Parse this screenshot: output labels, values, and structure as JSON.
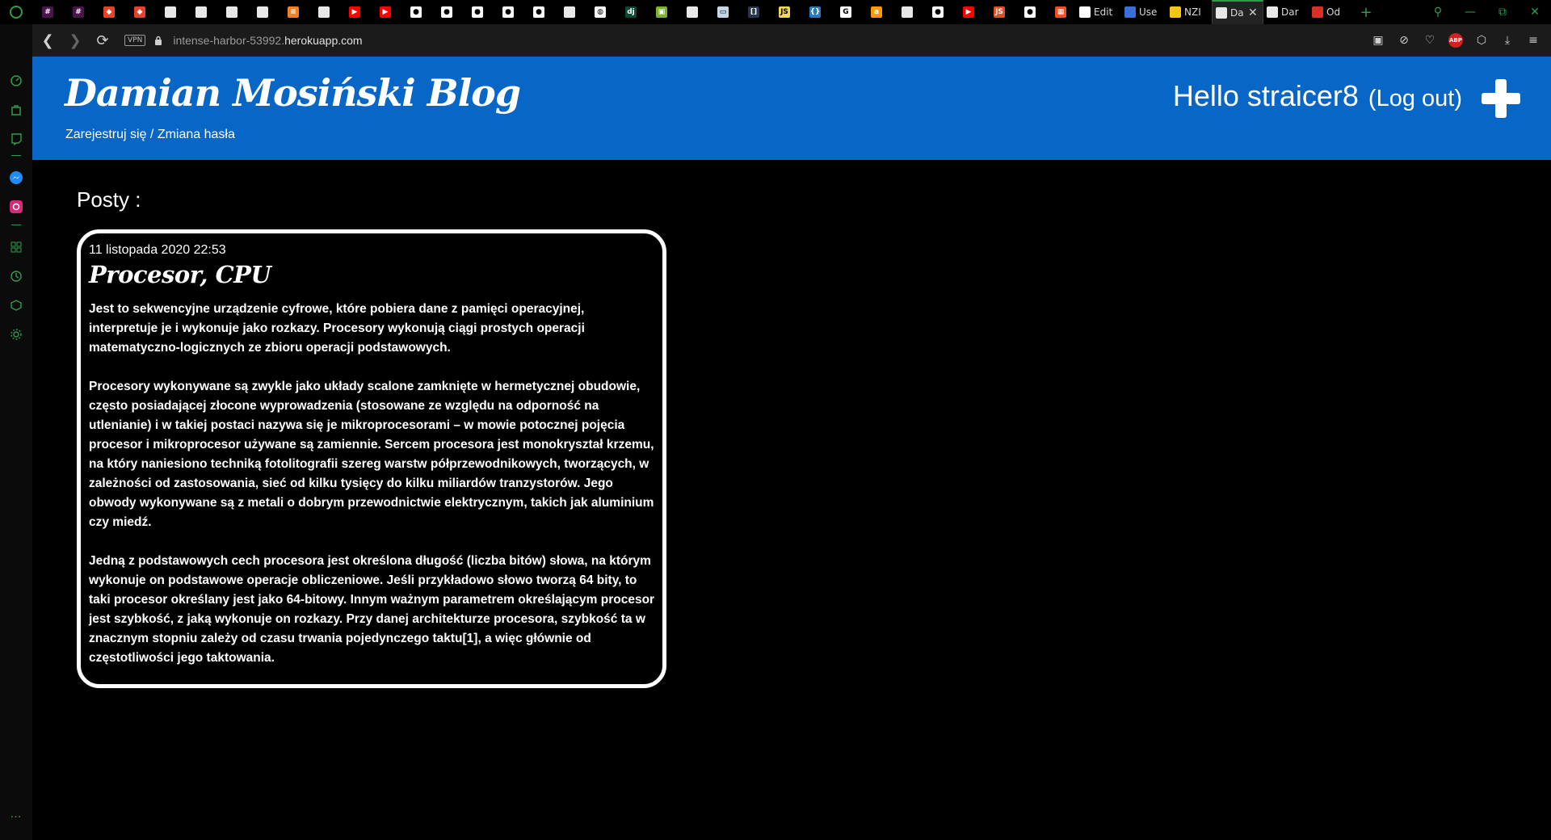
{
  "browser": {
    "tabs": [
      {
        "icon": "slack-icon",
        "color": "#4a154b",
        "glyph": "#"
      },
      {
        "icon": "slack-icon",
        "color": "#4a154b",
        "glyph": "#"
      },
      {
        "icon": "gitlab-icon",
        "color": "#e24329",
        "glyph": "◆"
      },
      {
        "icon": "gitlab-icon",
        "color": "#e24329",
        "glyph": "◆"
      },
      {
        "icon": "document-icon",
        "color": "#e8e8e8",
        "glyph": ""
      },
      {
        "icon": "document-icon",
        "color": "#e8e8e8",
        "glyph": ""
      },
      {
        "icon": "document-icon",
        "color": "#e8e8e8",
        "glyph": ""
      },
      {
        "icon": "document-icon",
        "color": "#e8e8e8",
        "glyph": ""
      },
      {
        "icon": "stackoverflow-icon",
        "color": "#f48024",
        "glyph": "≡"
      },
      {
        "icon": "document-icon",
        "color": "#e8e8e8",
        "glyph": ""
      },
      {
        "icon": "youtube-icon",
        "color": "#ff0000",
        "glyph": "▶"
      },
      {
        "icon": "youtube-icon",
        "color": "#ff0000",
        "glyph": "▶"
      },
      {
        "icon": "github-icon",
        "color": "#ffffff",
        "glyph": "●"
      },
      {
        "icon": "github-icon",
        "color": "#ffffff",
        "glyph": "●"
      },
      {
        "icon": "github-icon",
        "color": "#ffffff",
        "glyph": "●"
      },
      {
        "icon": "github-icon",
        "color": "#ffffff",
        "glyph": "●"
      },
      {
        "icon": "github-icon",
        "color": "#ffffff",
        "glyph": "●"
      },
      {
        "icon": "document-icon",
        "color": "#e8e8e8",
        "glyph": ""
      },
      {
        "icon": "globe-icon",
        "color": "#ffffff",
        "glyph": "◍"
      },
      {
        "icon": "django-icon",
        "color": "#0c4b33",
        "glyph": "dj"
      },
      {
        "icon": "image-icon",
        "color": "#7bb32e",
        "glyph": "▣"
      },
      {
        "icon": "document-icon",
        "color": "#e8e8e8",
        "glyph": ""
      },
      {
        "icon": "book-icon",
        "color": "#c9d6e8",
        "glyph": "▭"
      },
      {
        "icon": "bracket-icon",
        "color": "#2a3550",
        "glyph": "[]"
      },
      {
        "icon": "javascript-icon",
        "color": "#f0db4f",
        "glyph": "JS"
      },
      {
        "icon": "json-icon",
        "color": "#2b7bb9",
        "glyph": "{}"
      },
      {
        "icon": "google-icon",
        "color": "#ffffff",
        "glyph": "G"
      },
      {
        "icon": "amazon-icon",
        "color": "#ff9900",
        "glyph": "a"
      },
      {
        "icon": "document-icon",
        "color": "#e8e8e8",
        "glyph": ""
      },
      {
        "icon": "github-icon",
        "color": "#ffffff",
        "glyph": "●"
      },
      {
        "icon": "youtube-icon",
        "color": "#ff0000",
        "glyph": "▶"
      },
      {
        "icon": "javascript-icon",
        "color": "#e44d26",
        "glyph": "JS"
      },
      {
        "icon": "github-icon",
        "color": "#ffffff",
        "glyph": "●"
      },
      {
        "icon": "microsoft-icon",
        "color": "#f25022",
        "glyph": "▦"
      }
    ],
    "labeled_tabs": [
      {
        "icon": "github-icon",
        "color": "#ffffff",
        "label": "Edit"
      },
      {
        "icon": "form-icon",
        "color": "#3b6fd8",
        "label": "Use"
      },
      {
        "icon": "mail-icon",
        "color": "#f5c518",
        "label": "NZI"
      },
      {
        "icon": "document-icon",
        "color": "#e8e8e8",
        "label": "Da",
        "active": true
      },
      {
        "icon": "document-icon",
        "color": "#e8e8e8",
        "label": "Dar"
      },
      {
        "icon": "gmail-icon",
        "color": "#d93025",
        "label": "Od"
      }
    ],
    "url_host": "intense-harbor-53992.",
    "url_domain": "herokuapp.com",
    "vpn_label": "VPN",
    "abp_label": "ABP"
  },
  "header": {
    "title": "Damian Mosiński Blog",
    "register_link": "Zarejestruj się",
    "separator": " / ",
    "change_password_link": "Zmiana hasła",
    "greeting": "Hello straicer8",
    "logout_link": "(Log out)"
  },
  "main": {
    "posts_heading": "Posty :",
    "post": {
      "date": "11 listopada 2020 22:53",
      "title": "Procesor, CPU",
      "paragraphs": [
        "Jest to sekwencyjne urządzenie cyfrowe, które pobiera dane z pamięci operacyjnej, interpretuje je i wykonuje jako rozkazy. Procesory wykonują ciągi prostych operacji matematyczno-logicznych ze zbioru operacji podstawowych.",
        "Procesory wykonywane są zwykle jako układy scalone zamknięte w hermetycznej obudowie, często posiadającej złocone wyprowadzenia (stosowane ze względu na odporność na utlenianie) i w takiej postaci nazywa się je mikroprocesorami – w mowie potocznej pojęcia procesor i mikroprocesor używane są zamiennie. Sercem procesora jest monokryształ krzemu, na który naniesiono techniką fotolitografii szereg warstw półprzewodnikowych, tworzących, w zależności od zastosowania, sieć od kilku tysięcy do kilku miliardów tranzystorów. Jego obwody wykonywane są z metali o dobrym przewodnictwie elektrycznym, takich jak aluminium czy miedź.",
        "Jedną z podstawowych cech procesora jest określona długość (liczba bitów) słowa, na którym wykonuje on podstawowe operacje obliczeniowe. Jeśli przykładowo słowo tworzą 64 bity, to taki procesor określany jest jako 64-bitowy. Innym ważnym parametrem określającym procesor jest szybkość, z jaką wykonuje on rozkazy. Przy danej architekturze procesora, szybkość ta w znacznym stopniu zależy od czasu trwania pojedynczego taktu[1], a więc głównie od częstotliwości jego taktowania."
      ]
    }
  },
  "colors": {
    "header_bg": "#0866c6",
    "opera_green": "#2e9c4c"
  }
}
